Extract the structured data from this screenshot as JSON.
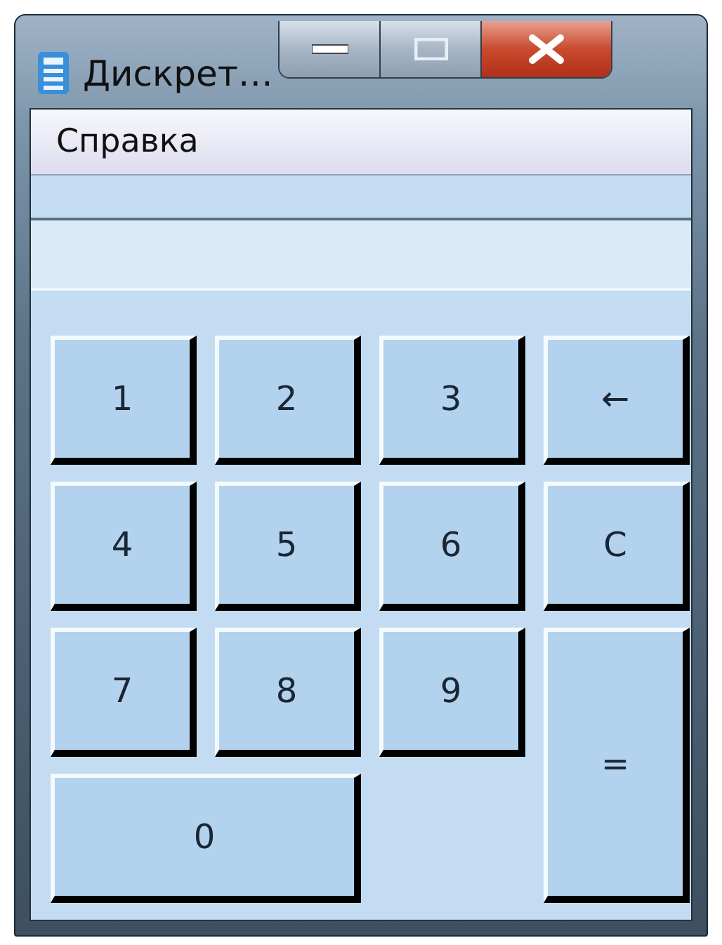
{
  "window": {
    "title": "Дискрет…"
  },
  "menu": [
    {
      "label": "Справка"
    }
  ],
  "keys": [
    {
      "label": "1",
      "kind": "normal"
    },
    {
      "label": "2",
      "kind": "normal"
    },
    {
      "label": "3",
      "kind": "normal"
    },
    {
      "label": "←",
      "kind": "normal"
    },
    {
      "label": "4",
      "kind": "normal"
    },
    {
      "label": "5",
      "kind": "normal"
    },
    {
      "label": "6",
      "kind": "normal"
    },
    {
      "label": "C",
      "kind": "normal"
    },
    {
      "label": "7",
      "kind": "normal"
    },
    {
      "label": "8",
      "kind": "normal"
    },
    {
      "label": "9",
      "kind": "normal"
    },
    {
      "label": "=",
      "kind": "tall"
    },
    {
      "label": "0",
      "kind": "wide"
    }
  ]
}
